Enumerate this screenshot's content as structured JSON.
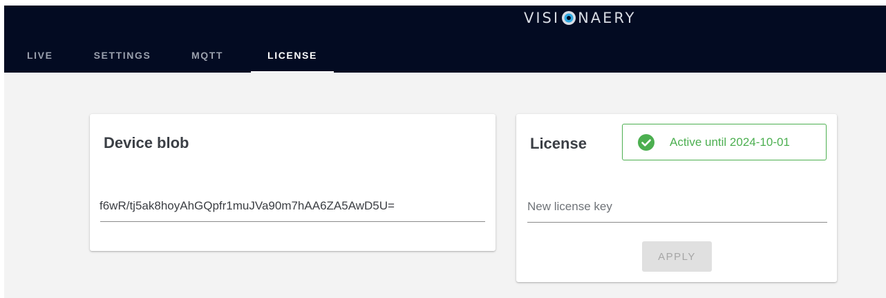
{
  "brand": {
    "logo_text_before": "VISI",
    "logo_text_after": "NAERY"
  },
  "tabs": [
    {
      "label": "LIVE"
    },
    {
      "label": "SETTINGS"
    },
    {
      "label": "MQTT"
    },
    {
      "label": "LICENSE",
      "active": true
    }
  ],
  "device_card": {
    "title": "Device blob",
    "blob_value": "f6wR/tj5ak8hoyAhGQpfr1muJVa90m7hAA6ZA5AwD5U="
  },
  "license_card": {
    "title": "License",
    "status": {
      "text": "Active until 2024-10-01",
      "icon": "check-circle-icon",
      "color": "#4caf50"
    },
    "key_input_placeholder": "New license key",
    "apply_label": "APPLY"
  },
  "colors": {
    "header_bg": "#030b22",
    "page_bg": "#f3f3f3",
    "success": "#4caf50"
  }
}
